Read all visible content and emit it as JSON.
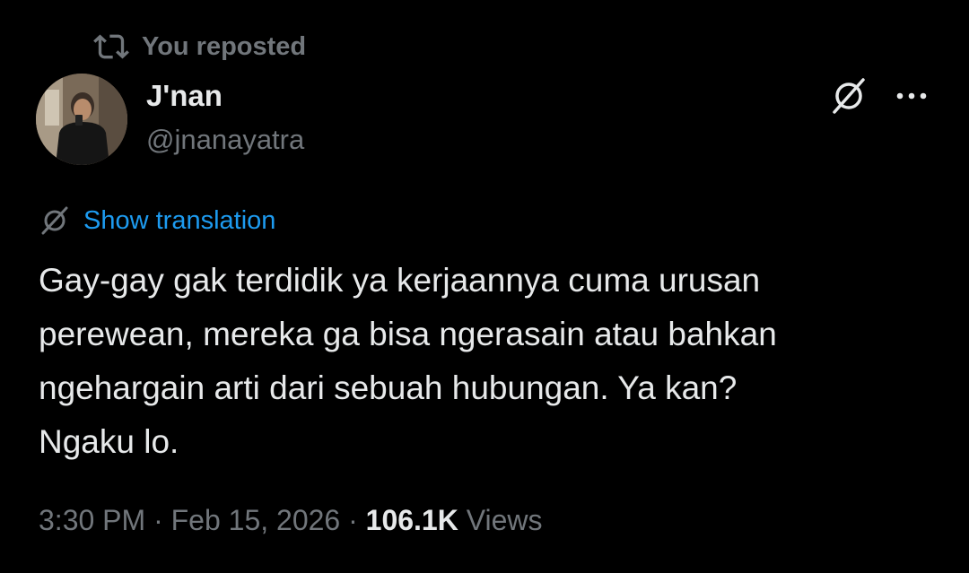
{
  "repost": {
    "label": "You reposted",
    "icon": "repost-icon"
  },
  "author": {
    "name": "J'nan",
    "handle": "@jnanayatra",
    "avatar_icon": "avatar"
  },
  "actions": {
    "grok_icon": "grok-icon",
    "more_icon": "more-icon"
  },
  "translation": {
    "label": "Show translation",
    "icon": "translate-icon"
  },
  "tweet": {
    "text": "Gay-gay gak terdidik ya kerjaannya cuma urusan\nperewean, mereka ga bisa ngerasain atau bahkan\nngehargain arti dari sebuah hubungan. Ya kan?\nNgaku lo."
  },
  "meta": {
    "time": "3:30 PM",
    "separator": " · ",
    "date": "Feb 15, 2026",
    "views_count": "106.1K",
    "views_label": " Views"
  },
  "colors": {
    "background": "#000000",
    "text_primary": "#e7e9ea",
    "text_secondary": "#71767b",
    "link": "#1d9bf0"
  }
}
